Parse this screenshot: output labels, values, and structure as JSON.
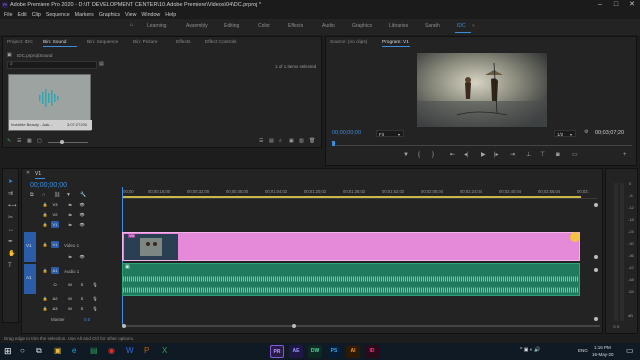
{
  "titlebar": {
    "title": "Adobe Premiere Pro 2020 - D:\\IT DEVELOPMENT CENTER\\10.Adobe Premiere\\Videos\\04\\DC.prproj *",
    "min": "–",
    "max": "□",
    "close": "✕"
  },
  "menu": [
    "File",
    "Edit",
    "Clip",
    "Sequence",
    "Markers",
    "Graphics",
    "View",
    "Window",
    "Help"
  ],
  "workspaces": [
    "Learning",
    "Assembly",
    "Editing",
    "Color",
    "Effects",
    "Audio",
    "Graphics",
    "Libraries",
    "Sarath",
    "IDC"
  ],
  "active_workspace": "IDC",
  "project_panel": {
    "tabs": [
      "Project: IDC",
      "Bin: Sound",
      "Bin: Sequence",
      "Bin: Picture",
      "Effects",
      "Effect Controls"
    ],
    "active_tab": "Bin: Sound",
    "path": "IDC.prproj\\Sound",
    "item_count": "1 of 1 items selected",
    "thumb_label": "Invisible Beauty - Aak...",
    "thumb_duration": "3:07:27200"
  },
  "program_panel": {
    "tabs": [
      "Source: (no clips)",
      "Program: V1"
    ],
    "active_tab": "Program: V1",
    "timecode": "00;00;00;00",
    "fit": "Fit",
    "resolution": "1/2",
    "duration": "00;03;07;20"
  },
  "timeline": {
    "tab": "V1",
    "timecode": "00;00;00;00",
    "ruler": [
      ":00;00",
      "00;00;16;00",
      "00;00;32;00",
      "00;00;48;00",
      "00;01;04;02",
      "00;01;20;02",
      "00;01;36;02",
      "00;01;52;02",
      "00;02;08;04",
      "00;02;24;04",
      "00;02;40;04",
      "00;02;56;04",
      "00;03;"
    ],
    "tracks": [
      "V3",
      "V2",
      "V1",
      "A1",
      "A2",
      "A3"
    ],
    "track_v1_name": "Video 1",
    "track_a1_name": "Audio 1",
    "master_label": "Master",
    "master_value": "0.0",
    "source_patch_v": "V1",
    "source_patch_a": "A1",
    "video_clip_label": "Vid",
    "mute_label": "M",
    "solo_label": "S",
    "toggle_label": "O"
  },
  "status_bar": {
    "hint": "Drag edge to trim the selection. Use Alt and Ctrl for other options."
  },
  "audio_meter": {
    "labels": [
      "0",
      "-6",
      "-12",
      "-18",
      "-24",
      "-30",
      "-36",
      "-42",
      "-48",
      "-54",
      "dB"
    ],
    "bottom": "S  S"
  },
  "taskbar": {
    "apps": [
      {
        "name": "PR",
        "color": "#2a1a4a",
        "text_color": "#b99cff"
      },
      {
        "name": "AE",
        "color": "#1f1747",
        "text_color": "#9b9cff"
      },
      {
        "name": "DW",
        "color": "#0d2a22",
        "text_color": "#4bde9c"
      },
      {
        "name": "PS",
        "color": "#061d33",
        "text_color": "#38a8ff"
      },
      {
        "name": "AI",
        "color": "#2d1a06",
        "text_color": "#ff9a22"
      },
      {
        "name": "ID",
        "color": "#2d0a1a",
        "text_color": "#ff3b8c"
      }
    ],
    "time": "1:16 PM",
    "date": "16-May-20",
    "lang": "ENG"
  }
}
